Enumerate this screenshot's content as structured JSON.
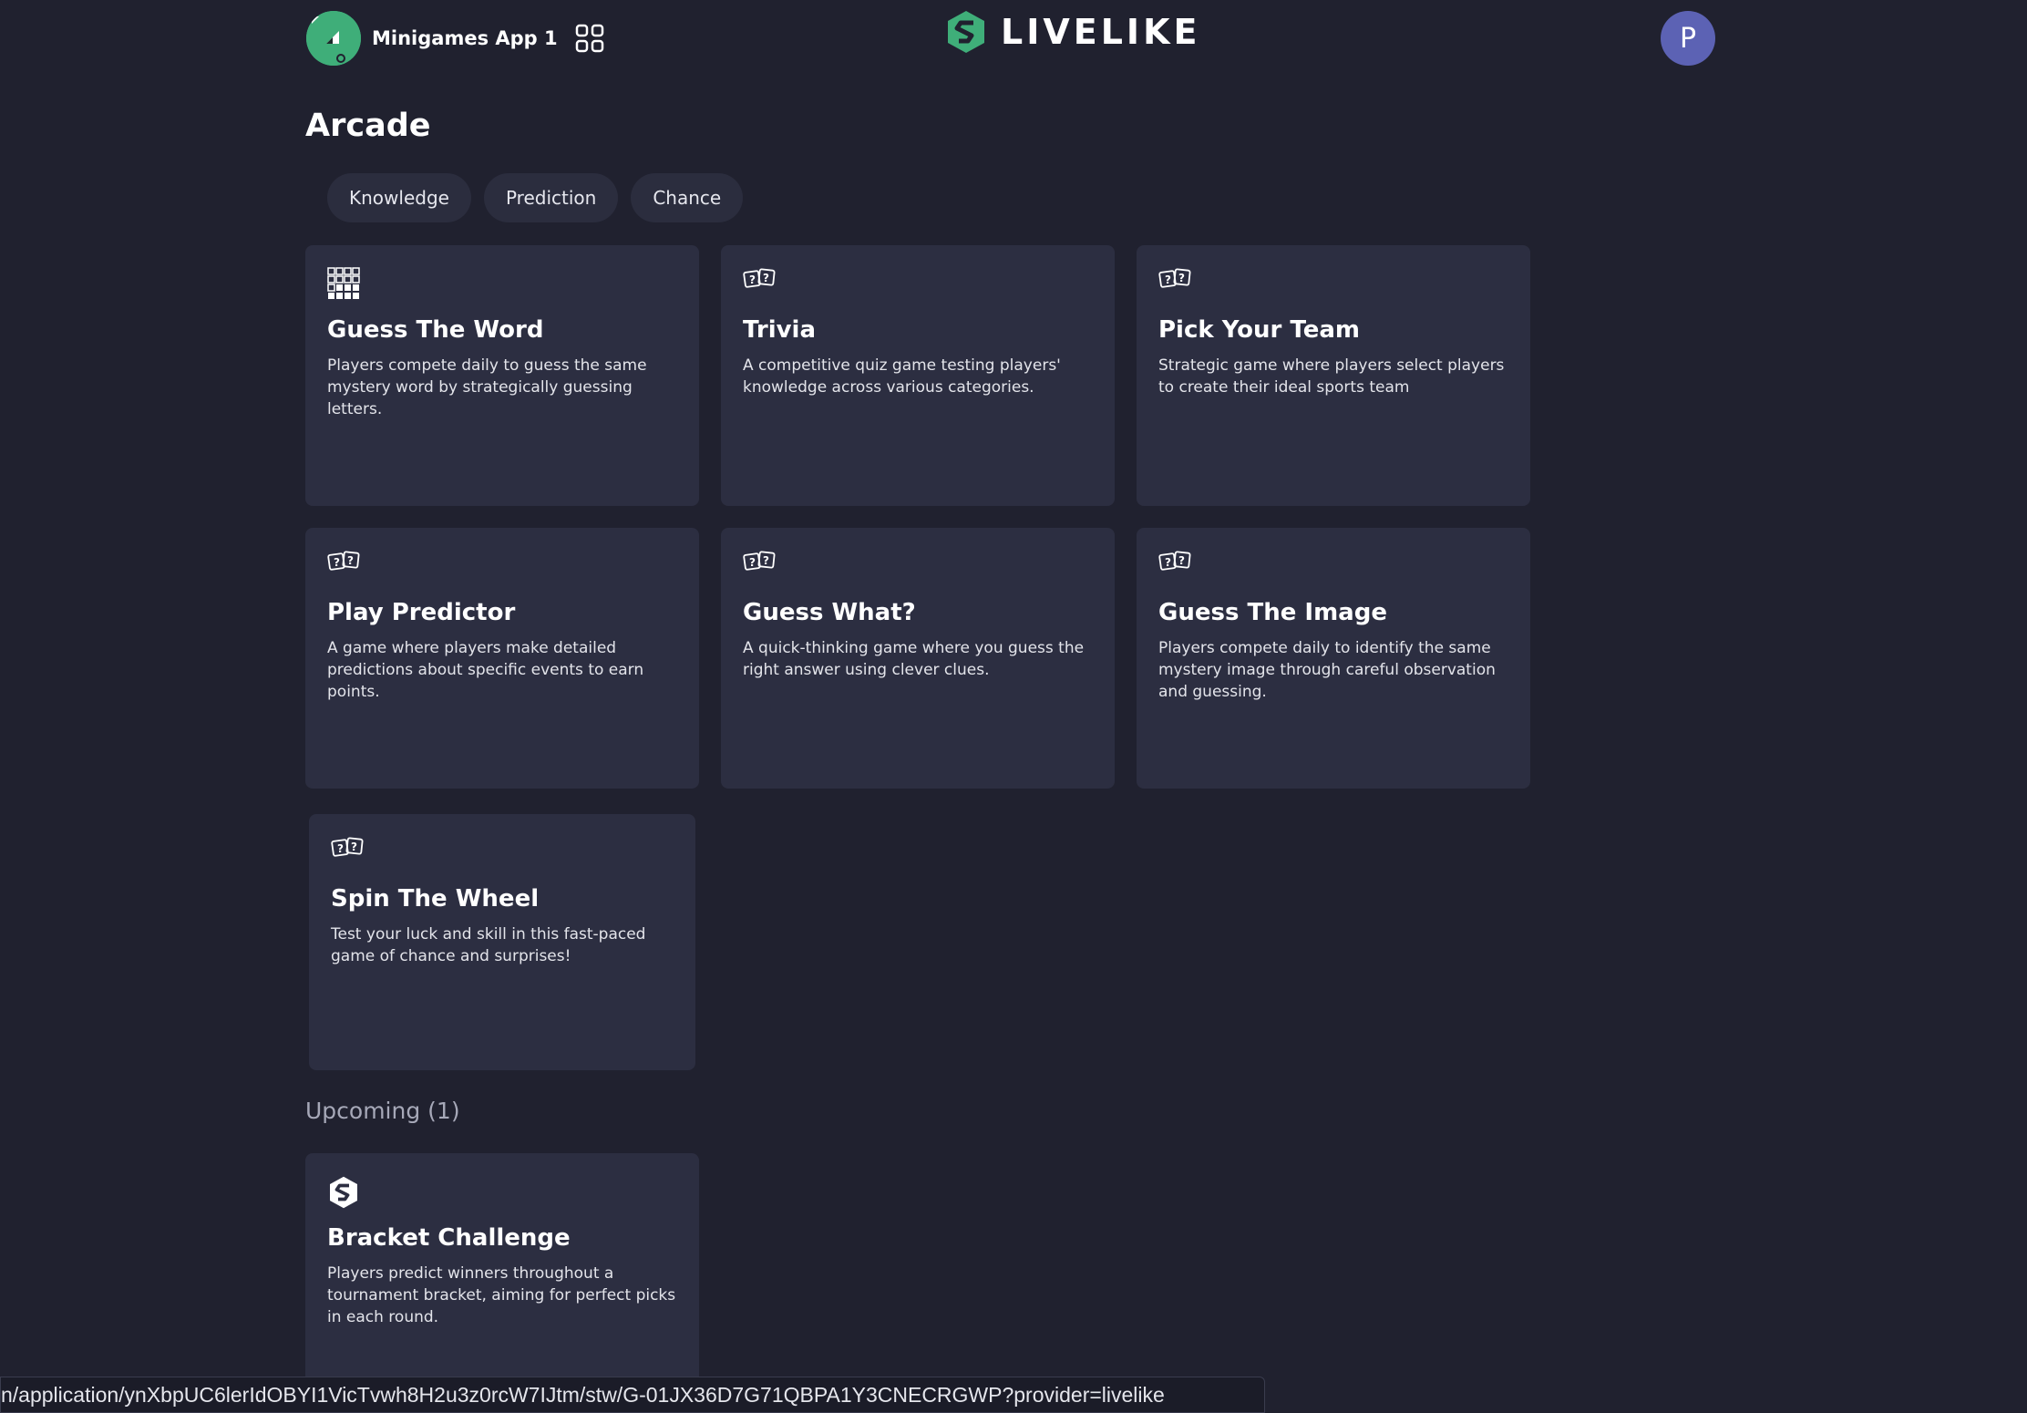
{
  "header": {
    "app_name": "Minigames App 1",
    "brand_name": "LIVELIKE",
    "avatar_letter": "P"
  },
  "section_title": "Arcade",
  "filters": [
    "Knowledge",
    "Prediction",
    "Chance"
  ],
  "games": [
    {
      "icon": "grid-puzzle-icon",
      "title": "Guess The Word",
      "description": "Players compete daily to guess the same mystery word by strategically guessing letters."
    },
    {
      "icon": "question-cards-icon",
      "title": "Trivia",
      "description": "A competitive quiz game testing players' knowledge across various categories."
    },
    {
      "icon": "question-cards-icon",
      "title": "Pick Your Team",
      "description": "Strategic game where players select players to create their ideal sports team"
    },
    {
      "icon": "question-cards-icon",
      "title": "Play Predictor",
      "description": "A game where players make detailed predictions about specific events to earn points."
    },
    {
      "icon": "question-cards-icon",
      "title": "Guess What?",
      "description": "A quick-thinking game where you guess the right answer using clever clues."
    },
    {
      "icon": "question-cards-icon",
      "title": "Guess The Image",
      "description": "Players compete daily to identify the same mystery image through careful observation and guessing."
    },
    {
      "icon": "question-cards-icon",
      "title": "Spin The Wheel",
      "description": "Test your luck and skill in this fast-paced game of chance and surprises!"
    }
  ],
  "upcoming": {
    "heading": "Upcoming (1)",
    "games": [
      {
        "icon": "livelike-logo-icon",
        "title": "Bracket Challenge",
        "description": "Players predict winners throughout a tournament bracket, aiming for perfect picks in each round."
      }
    ]
  },
  "status_url": "n/application/ynXbpUC6lerIdOBYI1VicTvwh8H2u3z0rcW7IJtm/stw/G-01JX36D7G71QBPA1Y3CNECRGWP?provider=livelike",
  "colors": {
    "background": "#20212f",
    "card": "#2c2e41",
    "chip": "#2b2d3e",
    "accent_green": "#3fae79",
    "avatar": "#5c62b4"
  }
}
